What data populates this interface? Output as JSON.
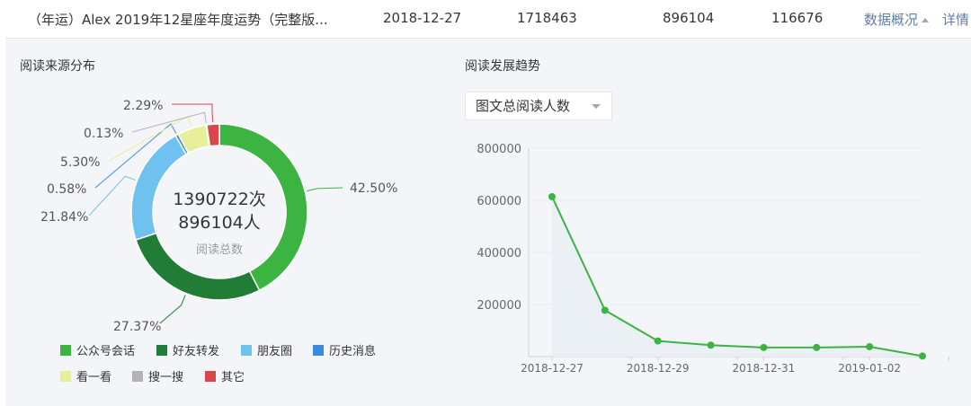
{
  "row": {
    "title": "（年运）Alex 2019年12星座年度运势（完整版...",
    "date": "2018-12-27",
    "v1": "1718463",
    "v2": "896104",
    "v3": "116676",
    "overview": "数据概况",
    "detail": "详情"
  },
  "left": {
    "title": "阅读来源分布",
    "center_line1": "1390722次",
    "center_line2": "896104人",
    "center_caption": "阅读总数"
  },
  "right": {
    "title": "阅读发展趋势",
    "select_value": "图文总阅读人数"
  },
  "legend": [
    "公众号会话",
    "好友转发",
    "朋友圈",
    "历史消息",
    "看一看",
    "搜一搜",
    "其它"
  ],
  "colors": {
    "green": "#3cb441",
    "darkgreen": "#217d35",
    "lightblue": "#6fc1ef",
    "blue": "#3d8ae4",
    "yellow": "#e7ef9a",
    "gray": "#b3b3b3",
    "red": "#d9474a"
  },
  "chart_data": [
    {
      "type": "pie",
      "labels": [
        "公众号会话",
        "好友转发",
        "朋友圈",
        "历史消息",
        "看一看",
        "搜一搜",
        "其它"
      ],
      "values": [
        42.5,
        27.37,
        21.84,
        0.58,
        5.3,
        0.13,
        2.29
      ],
      "value_labels": [
        "42.50%",
        "27.37%",
        "21.84%",
        "0.58%",
        "5.30%",
        "0.13%",
        "2.29%"
      ],
      "legend_position": "bottom"
    },
    {
      "type": "area",
      "x": [
        "2018-12-27",
        "2018-12-28",
        "2018-12-29",
        "2018-12-30",
        "2018-12-31",
        "2019-01-01",
        "2019-01-02",
        "2019-01-03"
      ],
      "x_tick_labels": [
        "2018-12-27",
        "2018-12-29",
        "2018-12-31",
        "2019-01-02"
      ],
      "values": [
        614000,
        178000,
        60000,
        44000,
        35000,
        35000,
        38000,
        2000
      ],
      "ylim": [
        0,
        800000
      ],
      "y_ticks": [
        200000,
        400000,
        600000,
        800000
      ],
      "y_tick_labels": [
        "200000",
        "400000",
        "600000",
        "800000"
      ],
      "grid": true,
      "color": "#3cb441"
    }
  ]
}
